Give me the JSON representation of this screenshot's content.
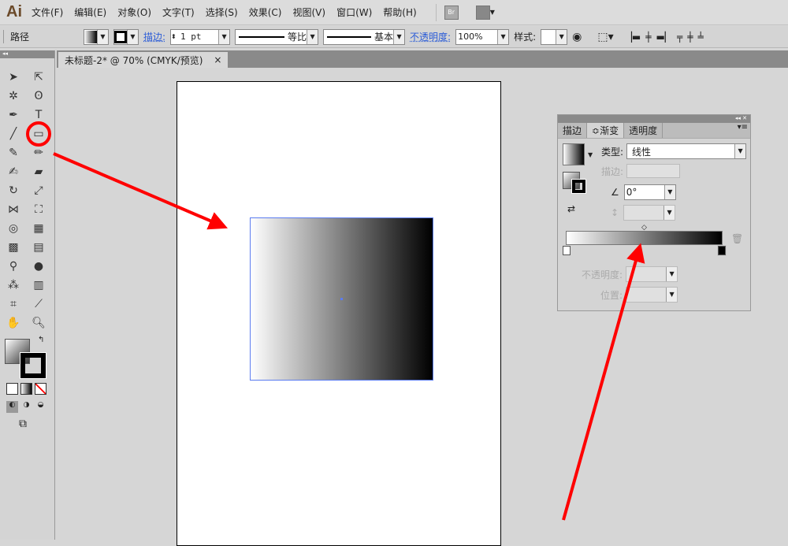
{
  "app": {
    "logo": "Ai",
    "menu": [
      "文件(F)",
      "编辑(E)",
      "对象(O)",
      "文字(T)",
      "选择(S)",
      "效果(C)",
      "视图(V)",
      "窗口(W)",
      "帮助(H)"
    ],
    "bridge": "Br"
  },
  "control": {
    "selection": "路径",
    "stroke_label": "描边:",
    "stroke_value": "1 pt",
    "profile": "等比",
    "brush": "基本",
    "opacity_label": "不透明度:",
    "opacity_value": "100%",
    "style_label": "样式:"
  },
  "document_tab": {
    "title": "未标题-2* @ 70% (CMYK/预览)",
    "close": "×"
  },
  "gradient_panel": {
    "tabs": [
      "描边",
      "≎渐变",
      "透明度"
    ],
    "type_label": "类型:",
    "type_value": "线性",
    "stroke_label": "描边:",
    "angle_value": "0°",
    "opacity_label": "不透明度:",
    "location_label": "位置:"
  },
  "colors": {
    "annotation": "#ff0000",
    "selection": "#5b7cf0"
  }
}
